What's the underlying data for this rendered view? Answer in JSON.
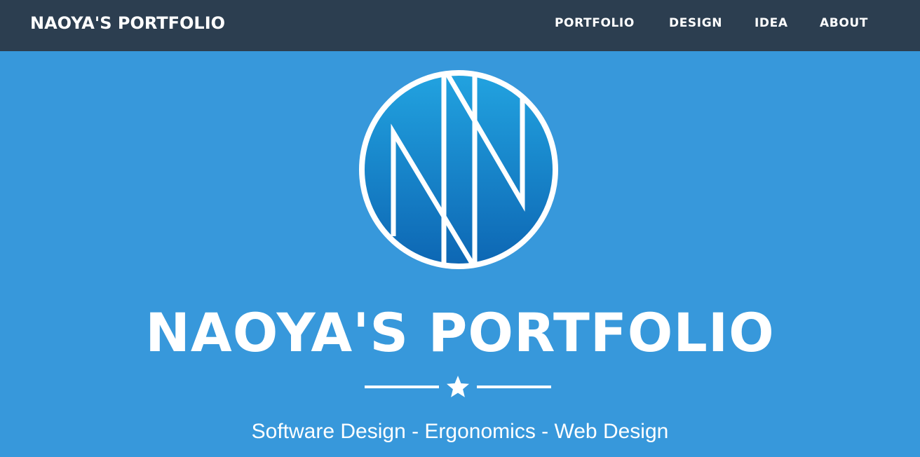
{
  "navbar": {
    "brand": "NAOYA'S PORTFOLIO",
    "links": [
      {
        "label": "PORTFOLIO"
      },
      {
        "label": "DESIGN"
      },
      {
        "label": "IDEA"
      },
      {
        "label": "ABOUT"
      }
    ]
  },
  "hero": {
    "logo_icon": "nn-monogram-logo-icon",
    "title": "NAOYA'S PORTFOLIO",
    "divider_icon": "star-icon",
    "tagline": "Software Design - Ergonomics - Web Design"
  },
  "colors": {
    "navbar_bg": "#2c3e50",
    "hero_bg": "#3798db",
    "logo_gradient_top": "#22a3e0",
    "logo_gradient_bottom": "#0d66b3",
    "text": "#ffffff"
  }
}
